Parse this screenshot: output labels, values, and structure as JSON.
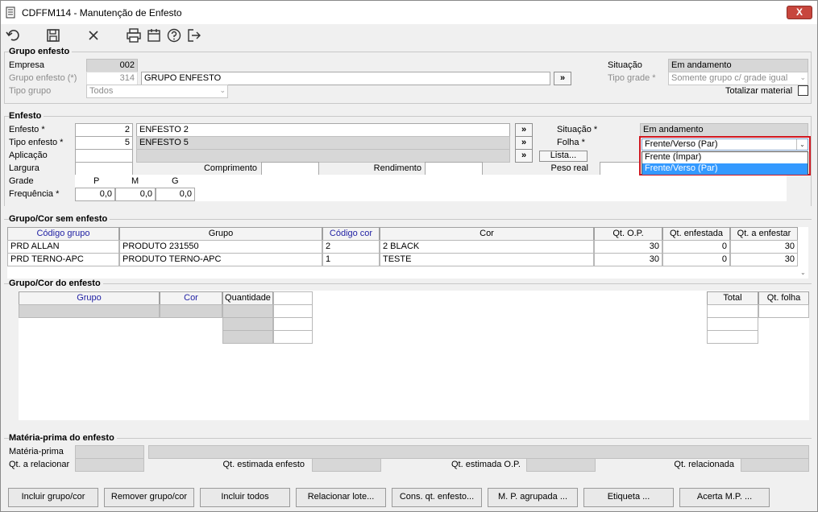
{
  "window": {
    "title": "CDFFM114 - Manutenção de Enfesto",
    "close": "X"
  },
  "toolbar": {
    "icons": [
      "undo-icon",
      "save-icon",
      "cancel-icon",
      "print-icon",
      "calendar-icon",
      "help-icon",
      "exit-icon"
    ]
  },
  "grupo_enfesto": {
    "title": "Grupo enfesto",
    "empresa_label": "Empresa",
    "empresa_value": "002",
    "grupo_label": "Grupo enfesto (*)",
    "grupo_code": "314",
    "grupo_name": "GRUPO ENFESTO",
    "tipo_grupo_label": "Tipo grupo",
    "tipo_grupo_value": "Todos",
    "situacao_label": "Situação",
    "situacao_value": "Em andamento",
    "tipo_grade_label": "Tipo grade *",
    "tipo_grade_value": "Somente grupo c/ grade igual",
    "totalizar_label": "Totalizar material",
    "lookup": "»"
  },
  "enfesto": {
    "title": "Enfesto",
    "enfesto_label": "Enfesto *",
    "enfesto_code": "2",
    "enfesto_name": "ENFESTO 2",
    "tipo_label": "Tipo enfesto *",
    "tipo_code": "5",
    "tipo_name": "ENFESTO 5",
    "aplicacao_label": "Aplicação",
    "largura_label": "Largura",
    "comprimento_label": "Comprimento",
    "rendimento_label": "Rendimento",
    "peso_label": "Peso real",
    "grade_label": "Grade",
    "frequencia_label": "Frequência *",
    "grade_sizes": [
      "P",
      "M",
      "G"
    ],
    "frequencias": [
      "0,0",
      "0,0",
      "0,0"
    ],
    "situacao_label": "Situação *",
    "situacao_value": "Em andamento",
    "folha_label": "Folha *",
    "folha_value": "Frente/Verso (Par)",
    "folha_options": [
      "Frente (Ímpar)",
      "Frente/Verso (Par)"
    ],
    "lista_label": "Lista...",
    "lookup": "»"
  },
  "sem_enfesto": {
    "title": "Grupo/Cor sem enfesto",
    "columns": [
      "Código grupo",
      "Grupo",
      "Código cor",
      "Cor",
      "Qt. O.P.",
      "Qt. enfestada",
      "Qt. a enfestar"
    ],
    "rows": [
      [
        "PRD ALLAN",
        "PRODUTO 231550",
        "2",
        "2 BLACK",
        "30",
        "0",
        "30"
      ],
      [
        "PRD TERNO-APC",
        "PRODUTO TERNO-APC",
        "1",
        "TESTE",
        "30",
        "0",
        "30"
      ]
    ]
  },
  "do_enfesto": {
    "title": "Grupo/Cor do enfesto",
    "columns": [
      "Grupo",
      "Cor",
      "Quantidade"
    ],
    "total_label": "Total",
    "qt_folha_label": "Qt. folha"
  },
  "materia_prima": {
    "title": "Matéria-prima do enfesto",
    "mp_label": "Matéria-prima",
    "qt_relacionar_label": "Qt. a relacionar",
    "qt_estimada_label": "Qt. estimada enfesto",
    "qt_estimada_op_label": "Qt. estimada O.P.",
    "qt_relacionada_label": "Qt. relacionada"
  },
  "buttons": {
    "incluir_grupo": "Incluir grupo/cor",
    "remover_grupo": "Remover grupo/cor",
    "incluir_todos": "Incluir todos",
    "relacionar_lote": "Relacionar lote...",
    "cons_qt": "Cons. qt. enfesto...",
    "mp_agrupada": "M. P. agrupada ...",
    "etiqueta": "Etiqueta ...",
    "acerta_mp": "Acerta M.P. ..."
  }
}
